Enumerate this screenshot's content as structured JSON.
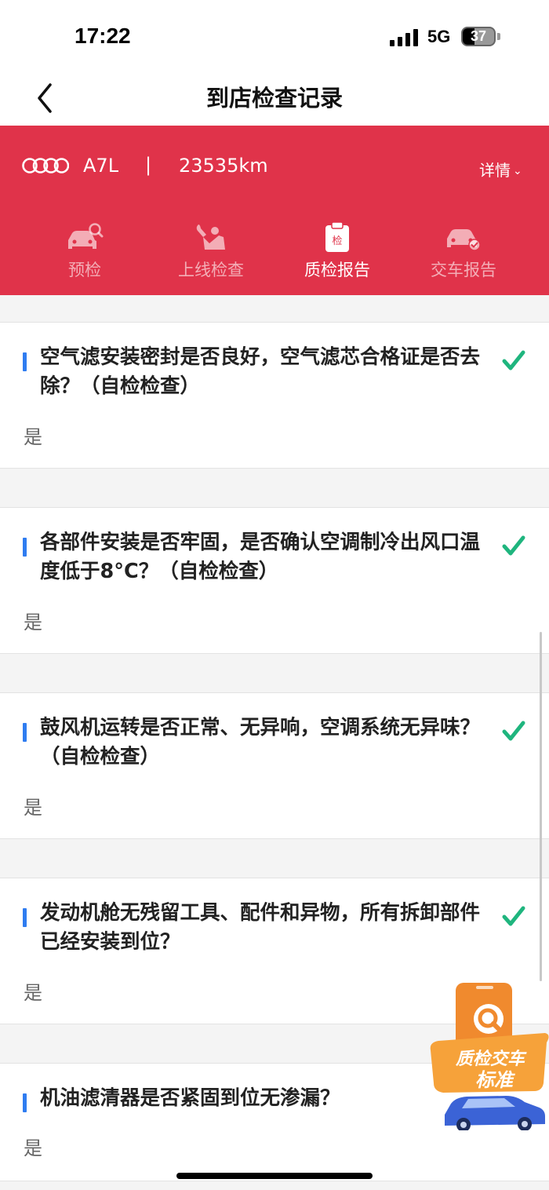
{
  "status_bar": {
    "time": "17:22",
    "network": "5G",
    "battery": 37
  },
  "nav": {
    "title": "到店检查记录"
  },
  "vehicle": {
    "brand": "audi-logo",
    "model": "A7L",
    "separator": "|",
    "mileage": "23535km",
    "details_label": "详情"
  },
  "tabs": [
    {
      "label": "预检",
      "icon": "car-search-icon",
      "active": false
    },
    {
      "label": "上线检查",
      "icon": "mechanic-icon",
      "active": false
    },
    {
      "label": "质检报告",
      "icon": "clipboard-icon",
      "icon_text": "检",
      "active": true
    },
    {
      "label": "交车报告",
      "icon": "car-check-icon",
      "active": false
    }
  ],
  "checks": [
    {
      "question": "空气滤安装密封是否良好，空气滤芯合格证是否去除？（自检检查）",
      "answer": "是",
      "passed": true
    },
    {
      "question": "各部件安装是否牢固，是否确认空调制冷出风口温度低于8°C？（自检检查）",
      "answer": "是",
      "passed": true
    },
    {
      "question": "鼓风机运转是否正常、无异响，空调系统无异味？（自检检查）",
      "answer": "是",
      "passed": true
    },
    {
      "question": "发动机舱无残留工具、配件和异物，所有拆卸部件已经安装到位？",
      "answer": "是",
      "passed": true
    },
    {
      "question": "机油滤清器是否紧固到位无渗漏？",
      "answer": "是",
      "passed": false
    }
  ],
  "promo": {
    "line1": "质检交车",
    "line2": "标准"
  },
  "colors": {
    "header": "#e0334a",
    "accent_bar": "#2f7cf0",
    "check": "#1fb57e"
  }
}
